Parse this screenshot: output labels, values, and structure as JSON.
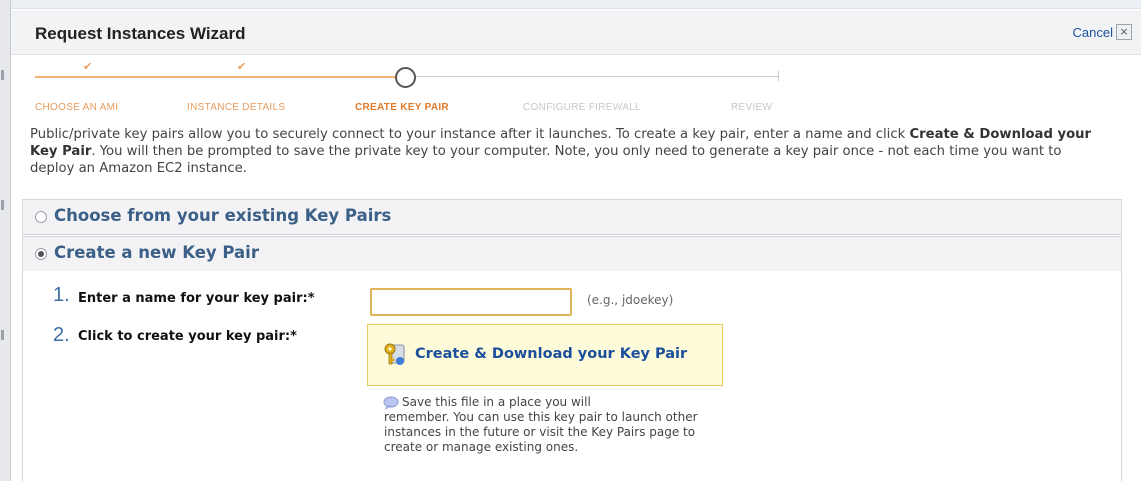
{
  "dialog": {
    "title": "Request Instances Wizard",
    "cancel_label": "Cancel",
    "close_glyph": "×"
  },
  "wizard": {
    "steps": [
      {
        "label": "CHOOSE AN AMI",
        "state": "done"
      },
      {
        "label": "INSTANCE DETAILS",
        "state": "done"
      },
      {
        "label": "CREATE KEY PAIR",
        "state": "current"
      },
      {
        "label": "CONFIGURE FIREWALL",
        "state": "todo"
      },
      {
        "label": "REVIEW",
        "state": "todo"
      }
    ],
    "check_glyph": "✔"
  },
  "intro": {
    "part1": "Public/private key pairs allow you to securely connect to your instance after it launches. To create a key pair, enter a name and click",
    "bold": "Create & Download your Key Pair",
    "part2": ". You will then be prompted to save the private key to your computer. Note, you only need to generate a key pair once - not each time you want to deploy an Amazon EC2 instance."
  },
  "options": {
    "existing_label": "Choose from your existing Key Pairs",
    "create_label": "Create a new Key Pair",
    "selected": "create"
  },
  "form": {
    "step1_number": "1.",
    "step1_label": "Enter a name for your key pair:*",
    "key_name_value": "",
    "key_name_example": "(e.g., jdoekey)",
    "step2_number": "2.",
    "step2_label": "Click to create your key pair:*",
    "create_button_label": "Create & Download your Key Pair",
    "hint_first_line": "Save this file in a place you will",
    "hint_rest": "remember. You can use this key pair to launch other instances in the future or visit the Key Pairs page to create or manage existing ones."
  },
  "icons": {
    "key": "key-icon",
    "hint": "speech-bubble-icon",
    "check": "check-icon",
    "close": "close-icon"
  },
  "colors": {
    "link_blue": "#1b4f9c",
    "section_blue": "#3b5f86",
    "step_current": "#e07a28",
    "step_done": "#e79b5c",
    "input_border": "#e0b35a",
    "button_bg": "#fdfbd9"
  }
}
